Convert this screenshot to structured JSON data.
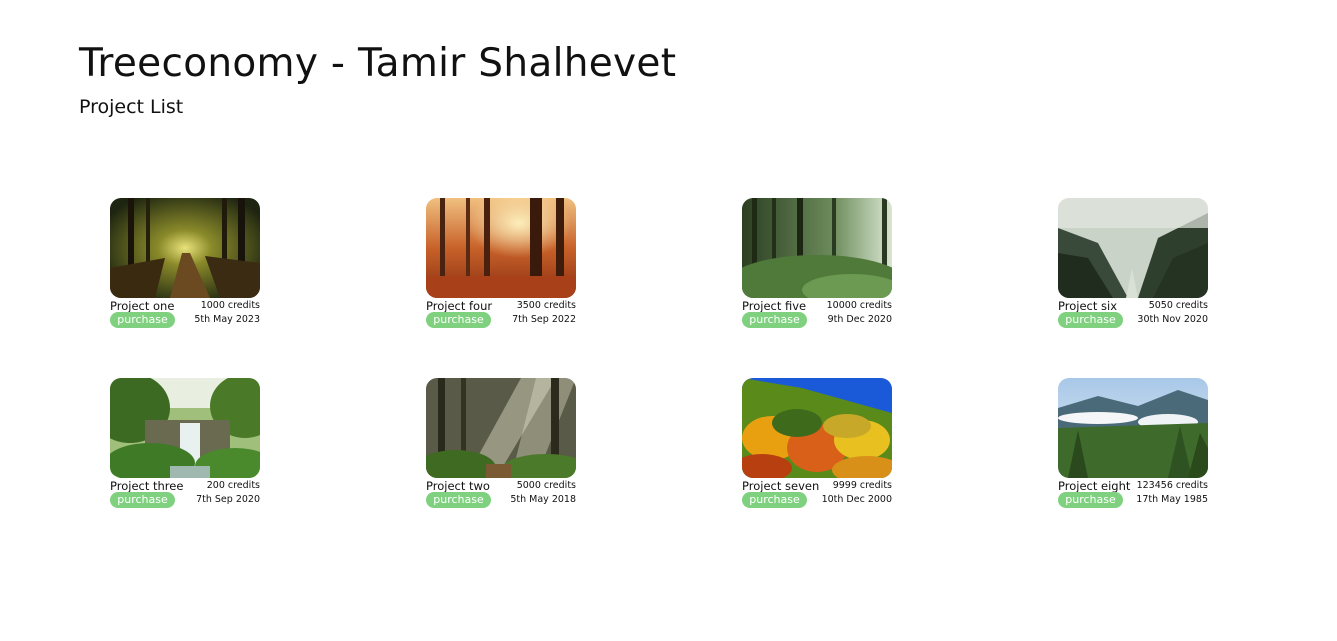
{
  "header": {
    "title": "Treeconomy - Tamir Shalhevet",
    "subtitle": "Project List"
  },
  "accent_color": "#7fd17f",
  "projects": [
    {
      "name": "Project one",
      "credits": "1000 credits",
      "date": "5th May 2023",
      "action": "purchase",
      "image": "sunlit forest path"
    },
    {
      "name": "Project four",
      "credits": "3500 credits",
      "date": "7th Sep 2022",
      "action": "purchase",
      "image": "autumn forest sunrays"
    },
    {
      "name": "Project five",
      "credits": "10000 credits",
      "date": "9th Dec 2020",
      "action": "purchase",
      "image": "green forest undergrowth"
    },
    {
      "name": "Project six",
      "credits": "5050 credits",
      "date": "30th Nov 2020",
      "action": "purchase",
      "image": "misty valley river"
    },
    {
      "name": "Project three",
      "credits": "200 credits",
      "date": "7th Sep 2020",
      "action": "purchase",
      "image": "jungle waterfall"
    },
    {
      "name": "Project two",
      "credits": "5000 credits",
      "date": "5th May 2018",
      "action": "purchase",
      "image": "forest light beams"
    },
    {
      "name": "Project seven",
      "credits": "9999 credits",
      "date": "10th Dec 2000",
      "action": "purchase",
      "image": "autumn hillside"
    },
    {
      "name": "Project eight",
      "credits": "123456 credits",
      "date": "17th May 1985",
      "action": "purchase",
      "image": "misty mountain pines"
    }
  ]
}
